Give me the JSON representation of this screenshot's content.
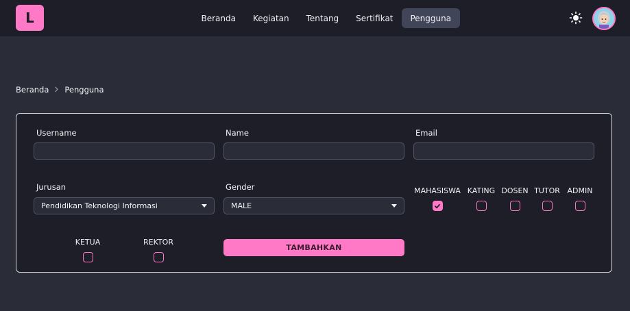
{
  "logo": {
    "letter": "L"
  },
  "nav": {
    "items": [
      {
        "label": "Beranda"
      },
      {
        "label": "Kegiatan"
      },
      {
        "label": "Tentang"
      },
      {
        "label": "Sertifikat"
      },
      {
        "label": "Pengguna"
      }
    ],
    "active": "Pengguna"
  },
  "header_icons": {
    "theme": "sun-icon",
    "avatar": "avatar"
  },
  "breadcrumb": {
    "home": "Beranda",
    "current": "Pengguna",
    "separator": ">"
  },
  "form": {
    "username_label": "Username",
    "username_value": "",
    "name_label": "Name",
    "name_value": "",
    "email_label": "Email",
    "email_value": "",
    "jurusan_label": "Jurusan",
    "jurusan_value": "Pendidikan Teknologi Informasi",
    "gender_label": "Gender",
    "gender_value": "MALE",
    "roles": [
      {
        "label": "MAHASISWA",
        "checked": true
      },
      {
        "label": "KATING",
        "checked": false
      },
      {
        "label": "DOSEN",
        "checked": false
      },
      {
        "label": "TUTOR",
        "checked": false
      },
      {
        "label": "ADMIN",
        "checked": false
      },
      {
        "label": "KETUA",
        "checked": false
      },
      {
        "label": "REKTOR",
        "checked": false
      }
    ],
    "submit_label": "TAMBAHKAN"
  },
  "colors": {
    "accent": "#ff79c6",
    "background": "#2a2c37",
    "panel": "#1d1e28",
    "nav_active": "#414558"
  }
}
